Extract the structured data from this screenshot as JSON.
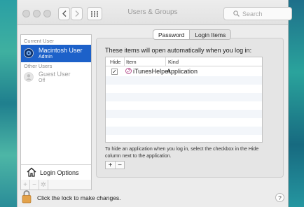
{
  "window": {
    "title": "Users & Groups"
  },
  "toolbar": {
    "back_icon": "chevron-left",
    "forward_icon": "chevron-right",
    "grid_icon": "grid",
    "search_placeholder": "Search"
  },
  "sidebar": {
    "current_user_label": "Current User",
    "current_user": {
      "name": "Macintosh User",
      "role": "Admin"
    },
    "other_users_label": "Other Users",
    "other_users": [
      {
        "name": "Guest User",
        "status": "Off"
      }
    ],
    "login_options": "Login Options",
    "add_label": "+",
    "remove_label": "−",
    "gear_label": "✲"
  },
  "tabs": {
    "password": "Password",
    "login_items": "Login Items",
    "selected": "Login Items"
  },
  "main": {
    "heading": "These items will open automatically when you log in:",
    "columns": {
      "hide": "Hide",
      "item": "Item",
      "kind": "Kind"
    },
    "rows": [
      {
        "hide": true,
        "item": "iTunesHelper",
        "kind": "Application"
      }
    ],
    "hint": "To hide an application when you log in, select the checkbox in the Hide column next to the application.",
    "add": "+",
    "remove": "−"
  },
  "footer": {
    "lock_text": "Click the lock to make changes.",
    "help": "?"
  }
}
